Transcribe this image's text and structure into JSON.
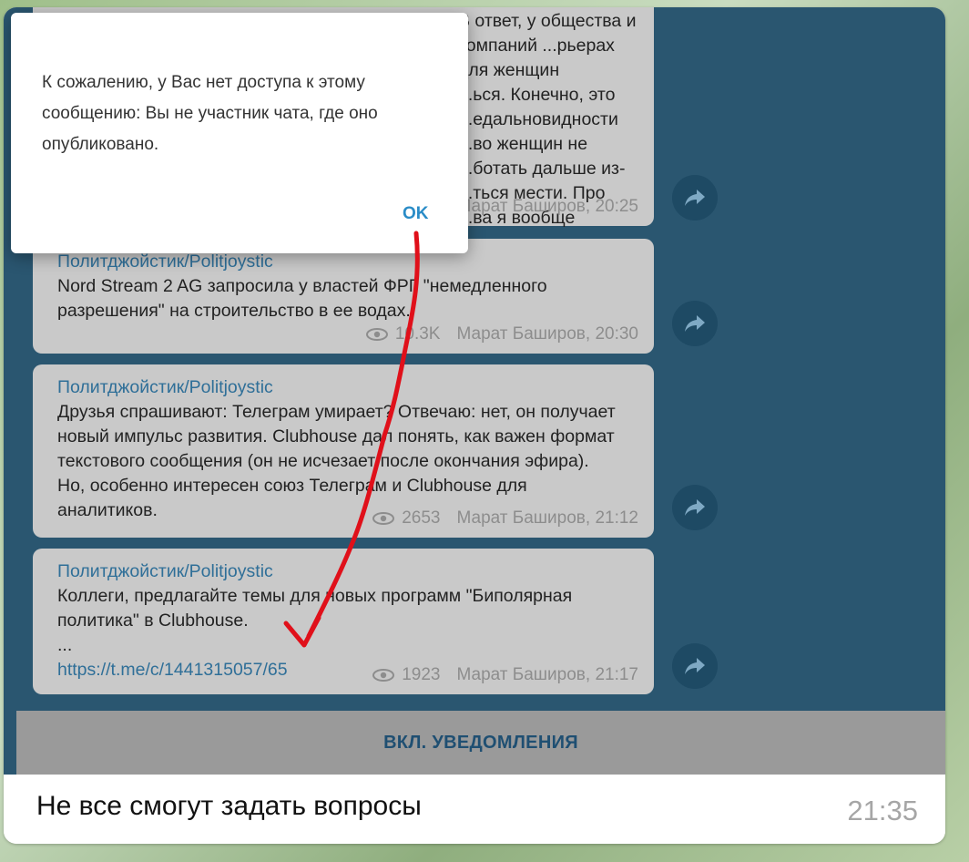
{
  "dialog": {
    "message": "К сожалению, у Вас нет доступа к этому сообщению: Вы не участник чата, где оно опубликовано.",
    "ok_label": "OK"
  },
  "posts": [
    {
      "channel": "",
      "text": "В ответ, у общества и компаний ...рьерах для женщин\n...ься. Конечно, это\n...едальновидности\n...во женщин не\n...ботать дальше из-\n...ться мести. Про\n...ва я вообще",
      "views": "",
      "author_time": "Марат Баширов, 20:25"
    },
    {
      "channel": "Политджойстик/Politjoystic",
      "text": "Nord Stream 2 AG запросила у властей ФРГ \"немедленного разрешения\" на строительство в ее водах.",
      "views": "10.3K",
      "author_time": "Марат Баширов, 20:30"
    },
    {
      "channel": "Политджойстик/Politjoystic",
      "text": "Друзья спрашивают: Телеграм умирает? Отвечаю: нет, он получает новый импульс развития. Clubhouse дал понять, как важен формат текстового сообщения (он не исчезает после окончания эфира). Но, особенно интересен союз Телеграм и Clubhouse для аналитиков.",
      "views": "2653",
      "author_time": "Марат Баширов, 21:12"
    },
    {
      "channel": "Политджойстик/Politjoystic",
      "text": "Коллеги, предлагайте темы для новых программ \"Биполярная политика\" в Clubhouse.\n...",
      "link": "https://t.me/c/1441315057/65",
      "views": "1923",
      "author_time": "Марат Баширов, 21:17"
    }
  ],
  "notify_label": "ВКЛ. УВЕДОМЛЕНИЯ",
  "caption": {
    "text": "Не все смогут задать вопросы",
    "time": "21:35"
  },
  "icons": [
    "eye-icon",
    "forward-icon"
  ],
  "colors": {
    "chat_bg": "#2a5670",
    "post_bg": "#c9c9c9",
    "link": "#2f6f98",
    "ok": "#2a8cc7",
    "annotation": "#e0101a"
  }
}
